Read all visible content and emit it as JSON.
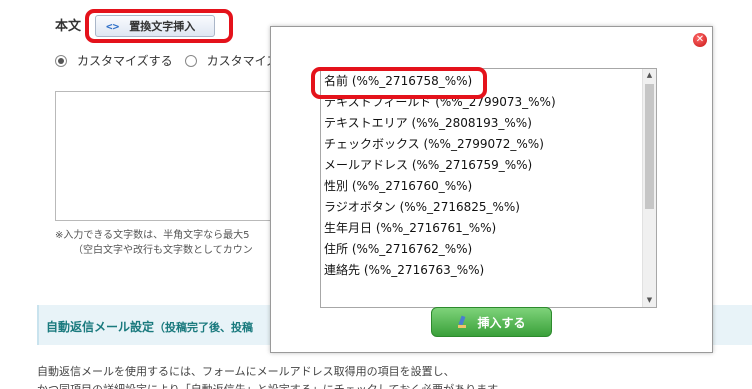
{
  "form": {
    "body_label": "本文",
    "insert_button": "置換文字挿入",
    "radio_custom_1": "カスタマイズする",
    "radio_custom_2": "カスタマイズ",
    "note_line1": "※入力できる文字数は、半角文字なら最大5",
    "note_line2": "（空白文字や改行も文字数としてカウン",
    "section_title": "自動返信メール設定",
    "section_note": "（投稿完了後、投稿",
    "desc_line1": "自動返信メールを使用するには、フォームにメールアドレス取得用の項目を設置し、",
    "desc_line2": "かつ同項目の詳細設定により「自動返信先」と設定する」にチェックしておく必要があります"
  },
  "modal": {
    "items": [
      "名前 (%%_2716758_%%)",
      "テキストフィールド (%%_2799073_%%)",
      "テキストエリア (%%_2808193_%%)",
      "チェックボックス (%%_2799072_%%)",
      "メールアドレス (%%_2716759_%%)",
      "性別 (%%_2716760_%%)",
      "ラジオボタン (%%_2716825_%%)",
      "生年月日 (%%_2716761_%%)",
      "住所 (%%_2716762_%%)",
      "連絡先 (%%_2716763_%%)"
    ],
    "submit_label": "挿入する"
  },
  "icons": {
    "insert_icon": "code-brackets-icon",
    "close_icon": "close-circle-icon",
    "submit_icon": "pen-icon"
  },
  "colors": {
    "highlight": "#e4121b",
    "submit_green": "#3aa03a",
    "section_bg": "#e8f3f8",
    "section_text": "#1a7a7e"
  }
}
